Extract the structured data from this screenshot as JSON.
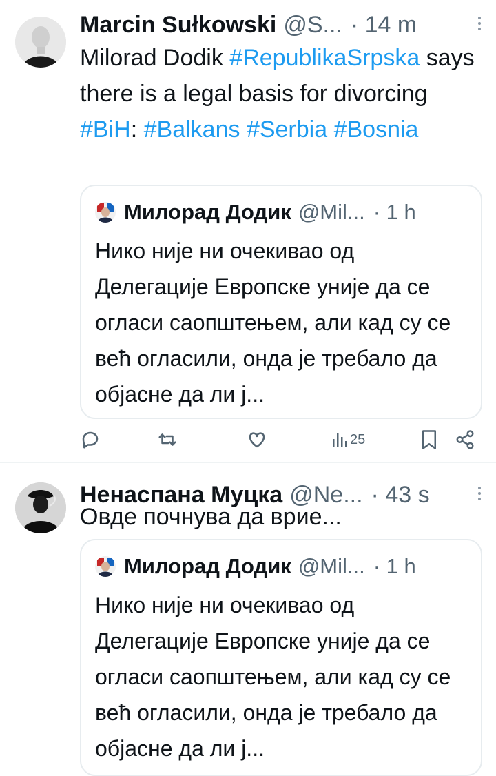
{
  "tweets": [
    {
      "author": "Marcin Sułkowski",
      "handle": "@S...",
      "time": "· 14 m",
      "text_segments": [
        "Milorad Dodik ",
        "#RepublikaSrpska",
        " says there is a legal basis for divorcing ",
        "#BiH",
        ": ",
        "#Balkans",
        " ",
        "#Serbia",
        " ",
        "#Bosnia"
      ],
      "quote": {
        "author": "Милорад Додик",
        "handle": "@Mil...",
        "time": "· 1 h",
        "text": "Нико није ни очекивао од Делегације Европске уније да се огласи саопштењем, али кад су се већ огласили, онда је требало да објасне да ли ј..."
      },
      "actions": {
        "views_count": "25",
        "icons": [
          "reply-icon",
          "retweet-icon",
          "like-icon",
          "views-icon",
          "bookmark-icon",
          "share-icon"
        ]
      }
    },
    {
      "author": "Ненаспана Муцка",
      "handle": "@Ne...",
      "time": "· 43 s",
      "text": "Овде почнува да врие...",
      "quote": {
        "author": "Милорад Додик",
        "handle": "@Mil...",
        "time": "· 1 h",
        "text": "Нико није ни очекивао од Делегације Европске уније да се огласи саопштењем, али кад су се већ огласили, онда је требало да објасне да ли ј..."
      }
    }
  ],
  "colors": {
    "link": "#1d9bf0",
    "muted": "#536471",
    "text": "#0f1419",
    "border": "#e7ecef"
  }
}
